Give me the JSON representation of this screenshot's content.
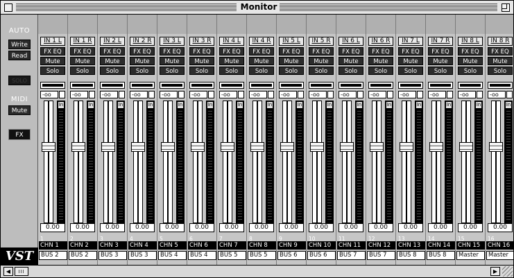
{
  "window": {
    "title": "Monitor"
  },
  "side_panel": {
    "auto_label": "AUTO",
    "write_label": "Write",
    "read_label": "Read",
    "solo_label": "SOLO",
    "midi_label": "MIDI",
    "midi_mute_label": "Mute",
    "fx_label": "FX",
    "logo": "VST"
  },
  "channels": [
    {
      "number": "1",
      "input": "IN 1 L",
      "fxeq": "FX EQ",
      "mute": "Mute",
      "solo": "Solo",
      "db": "-oo",
      "in_tag": "In",
      "fader_level": 0.63,
      "value": "0.00",
      "name": "CHN 1",
      "bus": "BUS 2"
    },
    {
      "number": "2",
      "input": "IN 1 R",
      "fxeq": "FX EQ",
      "mute": "Mute",
      "solo": "Solo",
      "db": "-oo",
      "in_tag": "In",
      "fader_level": 0.63,
      "value": "0.00",
      "name": "CHN 2",
      "bus": "BUS 2"
    },
    {
      "number": "3",
      "input": "IN 2 L",
      "fxeq": "FX EQ",
      "mute": "Mute",
      "solo": "Solo",
      "db": "-oo",
      "in_tag": "In",
      "fader_level": 0.63,
      "value": "0.00",
      "name": "CHN 3",
      "bus": "BUS 3"
    },
    {
      "number": "4",
      "input": "IN 2 R",
      "fxeq": "FX EQ",
      "mute": "Mute",
      "solo": "Solo",
      "db": "-oo",
      "in_tag": "In",
      "fader_level": 0.63,
      "value": "0.00",
      "name": "CHN 4",
      "bus": "BUS 3"
    },
    {
      "number": "5",
      "input": "IN 3 L",
      "fxeq": "FX EQ",
      "mute": "Mute",
      "solo": "Solo",
      "db": "-oo",
      "in_tag": "In",
      "fader_level": 0.63,
      "value": "0.00",
      "name": "CHN 5",
      "bus": "BUS 4"
    },
    {
      "number": "6",
      "input": "IN 3 R",
      "fxeq": "FX EQ",
      "mute": "Mute",
      "solo": "Solo",
      "db": "-oo",
      "in_tag": "In",
      "fader_level": 0.63,
      "value": "0.00",
      "name": "CHN 6",
      "bus": "BUS 4"
    },
    {
      "number": "7",
      "input": "IN 4 L",
      "fxeq": "FX EQ",
      "mute": "Mute",
      "solo": "Solo",
      "db": "-oo",
      "in_tag": "In",
      "fader_level": 0.63,
      "value": "0.00",
      "name": "CHN 7",
      "bus": "BUS 5"
    },
    {
      "number": "8",
      "input": "IN 4 R",
      "fxeq": "FX EQ",
      "mute": "Mute",
      "solo": "Solo",
      "db": "-oo",
      "in_tag": "In",
      "fader_level": 0.63,
      "value": "0.00",
      "name": "CHN 8",
      "bus": "BUS 5"
    },
    {
      "number": "9",
      "input": "IN 5 L",
      "fxeq": "FX EQ",
      "mute": "Mute",
      "solo": "Solo",
      "db": "-oo",
      "in_tag": "In",
      "fader_level": 0.63,
      "value": "0.00",
      "name": "CHN 9",
      "bus": "BUS 6"
    },
    {
      "number": "10",
      "input": "IN 5 R",
      "fxeq": "FX EQ",
      "mute": "Mute",
      "solo": "Solo",
      "db": "-oo",
      "in_tag": "In",
      "fader_level": 0.63,
      "value": "0.00",
      "name": "CHN 10",
      "bus": "BUS 6"
    },
    {
      "number": "11",
      "input": "IN 6 L",
      "fxeq": "FX EQ",
      "mute": "Mute",
      "solo": "Solo",
      "db": "-oo",
      "in_tag": "In",
      "fader_level": 0.63,
      "value": "0.00",
      "name": "CHN 11",
      "bus": "BUS 7"
    },
    {
      "number": "12",
      "input": "IN 6 R",
      "fxeq": "FX EQ",
      "mute": "Mute",
      "solo": "Solo",
      "db": "-oo",
      "in_tag": "In",
      "fader_level": 0.63,
      "value": "0.00",
      "name": "CHN 12",
      "bus": "BUS 7"
    },
    {
      "number": "13",
      "input": "IN 7 L",
      "fxeq": "FX EQ",
      "mute": "Mute",
      "solo": "Solo",
      "db": "-oo",
      "in_tag": "In",
      "fader_level": 0.63,
      "value": "0.00",
      "name": "CHN 13",
      "bus": "BUS 8"
    },
    {
      "number": "14",
      "input": "IN 7 R",
      "fxeq": "FX EQ",
      "mute": "Mute",
      "solo": "Solo",
      "db": "-oo",
      "in_tag": "In",
      "fader_level": 0.63,
      "value": "0.00",
      "name": "CHN 14",
      "bus": "BUS 8"
    },
    {
      "number": "15",
      "input": "IN 8 L",
      "fxeq": "FX EQ",
      "mute": "Mute",
      "solo": "Solo",
      "db": "-oo",
      "in_tag": "In",
      "fader_level": 0.63,
      "value": "0.00",
      "name": "CHN 15",
      "bus": "Master"
    },
    {
      "number": "16",
      "input": "IN 8 R",
      "fxeq": "FX EQ",
      "mute": "Mute",
      "solo": "Solo",
      "db": "-oo",
      "in_tag": "In",
      "fader_level": 0.63,
      "value": "0.00",
      "name": "CHN 16",
      "bus": "Master"
    }
  ],
  "scrollbar": {
    "left_arrow": "◀",
    "right_arrow": "▶"
  }
}
